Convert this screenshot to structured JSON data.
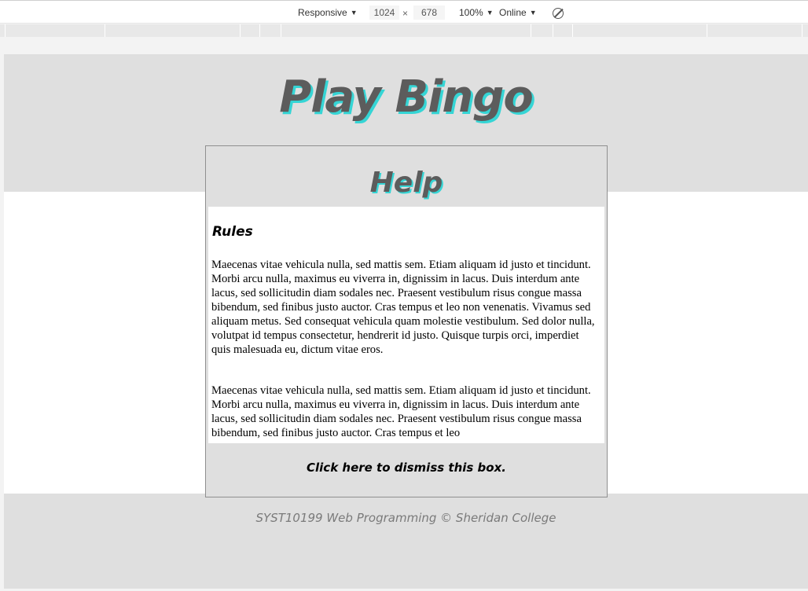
{
  "devtools": {
    "device": "Responsive",
    "width": "1024",
    "times": "×",
    "height": "678",
    "zoom": "100%",
    "network": "Online",
    "caret": "▼",
    "rotate_icon": "rotate-icon"
  },
  "page": {
    "title": "Play Bingo",
    "footer": "SYST10199 Web Programming © Sheridan College"
  },
  "dialog": {
    "title": "Help",
    "section_heading": "Rules",
    "paragraphs": [
      "Maecenas vitae vehicula nulla, sed mattis sem. Etiam aliquam id justo et tincidunt. Morbi arcu nulla, maximus eu viverra in, dignissim in lacus. Duis interdum ante lacus, sed sollicitudin diam sodales nec. Praesent vestibulum risus congue massa bibendum, sed finibus justo auctor. Cras tempus et leo non venenatis. Vivamus sed aliquam metus. Sed consequat vehicula quam molestie vestibulum. Sed dolor nulla, volutpat id tempus consectetur, hendrerit id justo. Quisque turpis orci, imperdiet quis malesuada eu, dictum vitae eros.",
      "Maecenas vitae vehicula nulla, sed mattis sem. Etiam aliquam id justo et tincidunt. Morbi arcu nulla, maximus eu viverra in, dignissim in lacus. Duis interdum ante lacus, sed sollicitudin diam sodales nec. Praesent vestibulum risus congue massa bibendum, sed finibus justo auctor. Cras tempus et leo"
    ],
    "dismiss": "Click here to dismiss this box."
  },
  "colors": {
    "title_text": "#5c5c5c",
    "title_shadow": "#35d5d5",
    "band_background": "#dfdfdf",
    "footer_text": "#7a7a7a"
  }
}
